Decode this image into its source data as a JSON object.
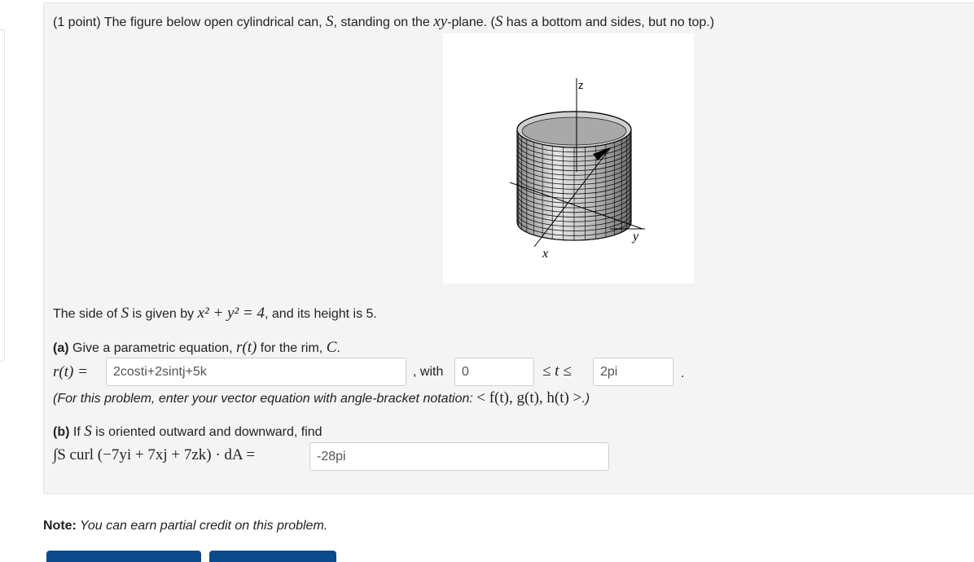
{
  "problem": {
    "intro": "(1 point) The figure below open cylindrical can, S, standing on the xy-plane. (S has a bottom and sides, but no top.)",
    "intro_a": "(1 point) The figure below open cylindrical can, ",
    "intro_S": "S",
    "intro_b": ", standing on the ",
    "intro_xy": "xy",
    "intro_c": "-plane. (",
    "intro_S2": "S",
    "intro_d": " has a bottom and sides, but no top.)",
    "figure_labels": {
      "z": "z",
      "x": "x",
      "y": "y"
    },
    "side_a": "The side of ",
    "side_S": "S",
    "side_b": " is given by ",
    "side_eq": "x² + y² = 4",
    "side_c": ", and its height is 5."
  },
  "part_a": {
    "label": "(a)",
    "text_a": " Give a parametric equation, ",
    "r_t": "r(t)",
    "text_b": " for the rim, ",
    "C": "C",
    "text_c": ".",
    "lhs": "r(t) =",
    "answer_value": "2costi+2sintj+5k",
    "with_label": ", with",
    "t_lower_value": "0",
    "ineq": "≤ t ≤",
    "t_upper_value": "2pi",
    "period": ".",
    "hint_a": "(For this problem, enter your vector equation with angle-bracket notation: ",
    "hint_math": "< f(t), g(t), h(t) >",
    "hint_b": ".)"
  },
  "part_b": {
    "label": "(b)",
    "text_a": " If ",
    "S": "S",
    "text_b": " is oriented outward and downward, find",
    "integral": "∫S curl (−7yi + 7xj + 7zk) · dA =",
    "answer_value": "-28pi"
  },
  "note": {
    "label": "Note:",
    "text": " You can earn partial credit on this problem."
  },
  "colors": {
    "button": "#0b4a8b",
    "box_bg": "#f4f4f4"
  }
}
